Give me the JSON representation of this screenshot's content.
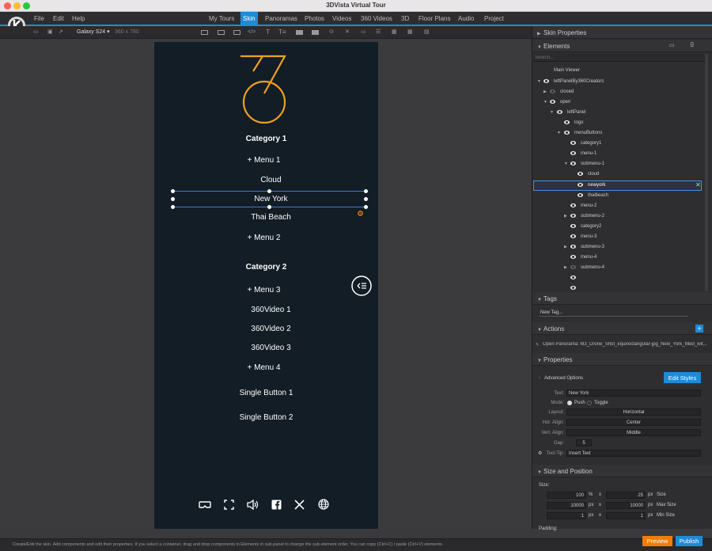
{
  "window": {
    "title": "3DVista Virtual Tour"
  },
  "menu": {
    "file": "File",
    "edit": "Edit",
    "help": "Help"
  },
  "nav": {
    "tabs": [
      "My Tours",
      "Skin",
      "Panoramas",
      "Photos",
      "Videos",
      "360 Videos",
      "3D",
      "Floor Plans",
      "Audio",
      "Project"
    ],
    "active": "Skin"
  },
  "toolbar": {
    "device": "Galaxy S24",
    "resolution": "360 x 780"
  },
  "phone": {
    "category1": "Category 1",
    "menu1": "+  Menu 1",
    "cloud": "Cloud",
    "newyork": "New York",
    "thaibeach": "Thai Beach",
    "menu2": "+  Menu 2",
    "category2": "Category 2",
    "menu3": "+  Menu 3",
    "video1": "360Video 1",
    "video2": "360Video 2",
    "video3": "360Video 3",
    "menu4": "+  Menu 4",
    "single1": "Single Button 1",
    "single2": "Single Button 2"
  },
  "panel": {
    "skin_properties": "Skin Properties",
    "elements": "Elements",
    "search_placeholder": "Search...",
    "main_viewer": "Main Viewer",
    "tree": [
      "leftPanelBy360Creators",
      "closed",
      "open",
      "leftPanel",
      "logo",
      "menuButtons",
      "category1",
      "menu-1",
      "submenu-1",
      "cloud",
      "newyork",
      "thaibeach",
      "menu-2",
      "submenu-2",
      "category2",
      "menu-3",
      "submenu-3",
      "menu-4",
      "submenu-4"
    ],
    "tags": "Tags",
    "new_tag": "New Tag...",
    "actions": "Actions",
    "action_text": "Open Panorama: M3_Drone_Shot_equirectangular-jpg_New_York_filled_wit...",
    "properties": "Properties",
    "advanced_options": "Advanced Options",
    "edit_styles": "Edit Styles",
    "text_label": "Text:",
    "text_value": "New York",
    "mode_label": "Mode:",
    "mode_push": "Push",
    "mode_toggle": "Toggle",
    "layout_label": "Layout:",
    "layout_value": "Horizontal",
    "halign_label": "Hor. Align:",
    "halign_value": "Center",
    "valign_label": "Vert. Align:",
    "valign_value": "Middle",
    "gap_label": "Gap:",
    "gap_value": "5",
    "tooltip_label": "Tool Tip:",
    "tooltip_value": "Insert Text",
    "size_position": "Size and Position",
    "size_label": "Size:",
    "size_w": "100",
    "size_w_unit": "%",
    "size_h": "25",
    "size_h_unit": "px",
    "size_caption": "Size",
    "max_w": "10000",
    "max_h": "10000",
    "max_caption": "Max Size",
    "min_w": "1",
    "min_h": "1",
    "min_caption": "Min Size",
    "px": "px",
    "x": "x",
    "padding_label": "Padding:"
  },
  "status": {
    "text": "Create/Edit the skin. Add components and edit their properties. If you select a container, drag and drop components in Elements in sub-panel to change the sub-element order. You can copy (Ctrl+C) / paste (Ctrl+V) elements."
  },
  "buttons": {
    "preview": "Preview",
    "publish": "Publish"
  }
}
